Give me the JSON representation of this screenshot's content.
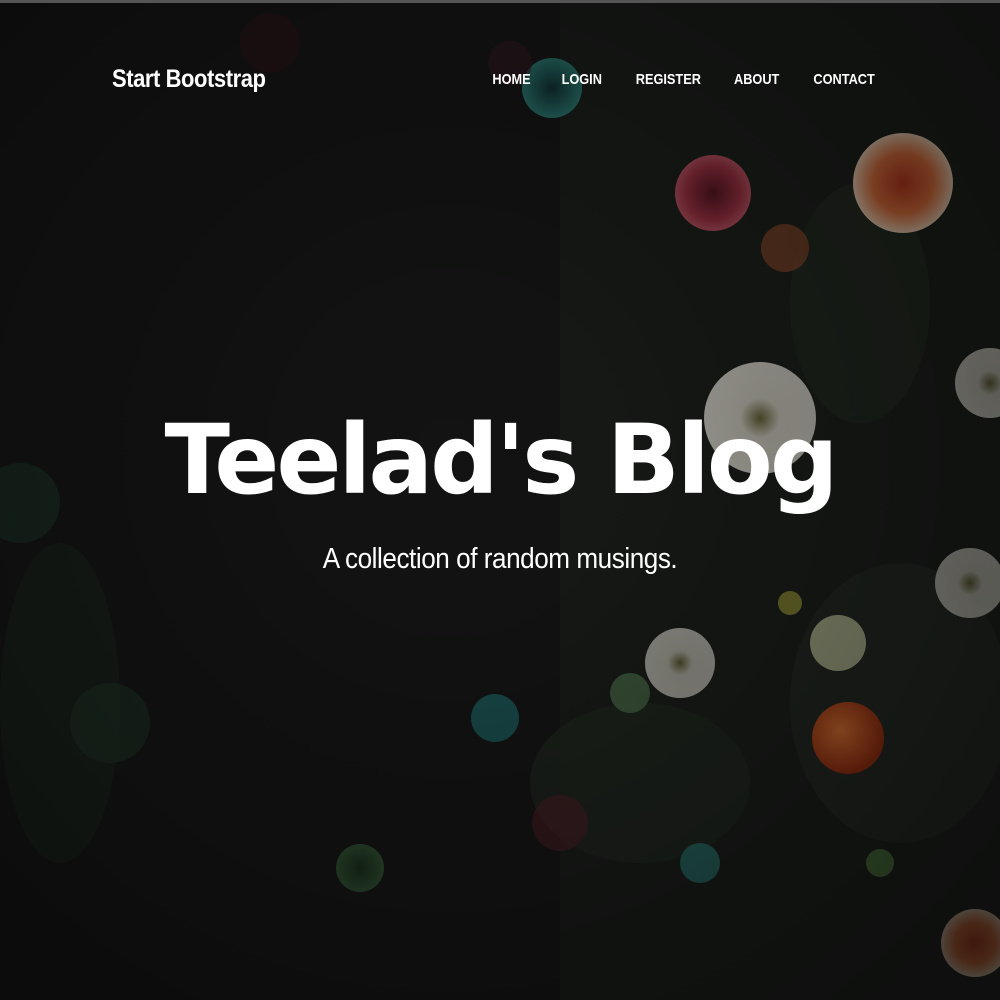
{
  "navbar": {
    "brand": "Start Bootstrap",
    "links": [
      {
        "label": "HOME"
      },
      {
        "label": "LOGIN"
      },
      {
        "label": "REGISTER"
      },
      {
        "label": "ABOUT"
      },
      {
        "label": "CONTACT"
      }
    ]
  },
  "hero": {
    "title": "Teelad's Blog",
    "subtitle": "A collection of random musings.",
    "background": "sea-anemones-photo",
    "colors": {
      "background": "#141414",
      "text": "#ffffff"
    }
  }
}
